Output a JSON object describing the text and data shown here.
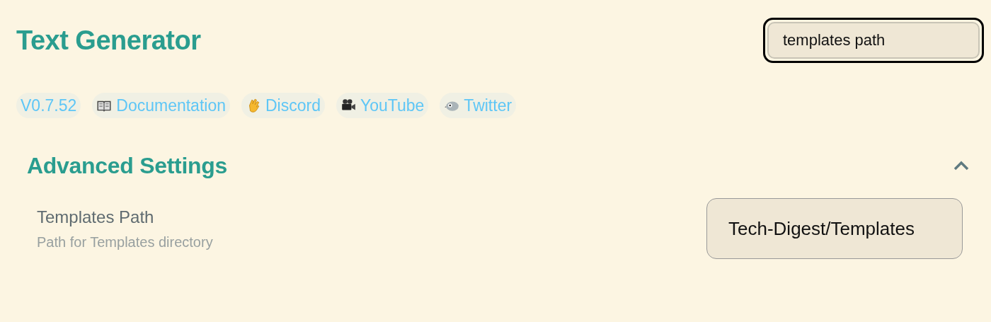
{
  "title": "Text Generator",
  "search": {
    "value": "templates path"
  },
  "links": [
    {
      "kind": "version",
      "label": "V0.7.52"
    },
    {
      "kind": "book",
      "label": "Documentation"
    },
    {
      "kind": "hand",
      "label": "Discord"
    },
    {
      "kind": "camera",
      "label": "YouTube"
    },
    {
      "kind": "bird",
      "label": "Twitter"
    }
  ],
  "section": {
    "title": "Advanced Settings",
    "expanded": true,
    "settings": [
      {
        "name": "Templates Path",
        "description": "Path for Templates directory",
        "value": "Tech-Digest/Templates"
      }
    ]
  }
}
